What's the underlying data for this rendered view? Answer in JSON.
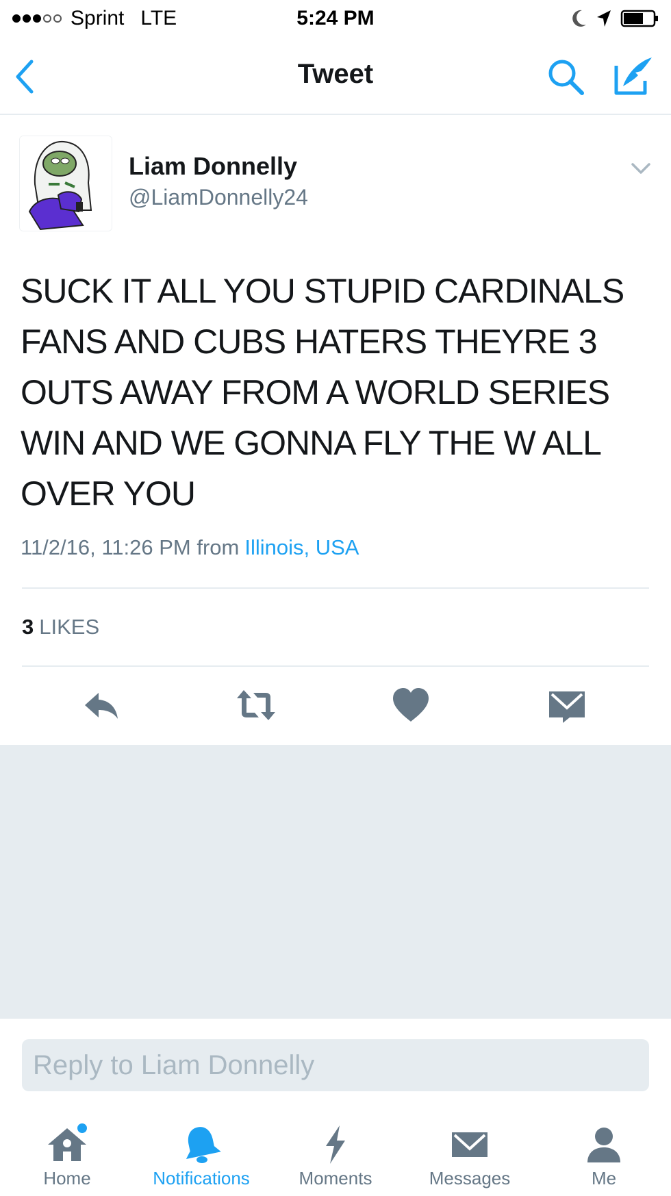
{
  "status_bar": {
    "carrier": "Sprint",
    "network": "LTE",
    "time": "5:24 PM"
  },
  "nav": {
    "title": "Tweet"
  },
  "tweet": {
    "author_name": "Liam Donnelly",
    "author_handle": "@LiamDonnelly24",
    "text": "SUCK IT ALL YOU STUPID CARDINALS FANS AND CUBS HATERS THEYRE 3 OUTS AWAY FROM A WORLD SERIES WIN AND WE GONNA FLY THE W ALL OVER YOU",
    "timestamp": "11/2/16, 11:26 PM from",
    "location": "Illinois, USA",
    "likes_count": "3",
    "likes_label": "LIKES"
  },
  "reply": {
    "placeholder": "Reply to Liam Donnelly"
  },
  "tabs": [
    {
      "label": "Home",
      "icon": "home-icon"
    },
    {
      "label": "Notifications",
      "icon": "bell-icon",
      "active": true
    },
    {
      "label": "Moments",
      "icon": "lightning-icon"
    },
    {
      "label": "Messages",
      "icon": "envelope-icon"
    },
    {
      "label": "Me",
      "icon": "person-icon"
    }
  ],
  "colors": {
    "accent": "#1da1f2",
    "muted": "#657786",
    "divider": "#e6ecf0"
  }
}
